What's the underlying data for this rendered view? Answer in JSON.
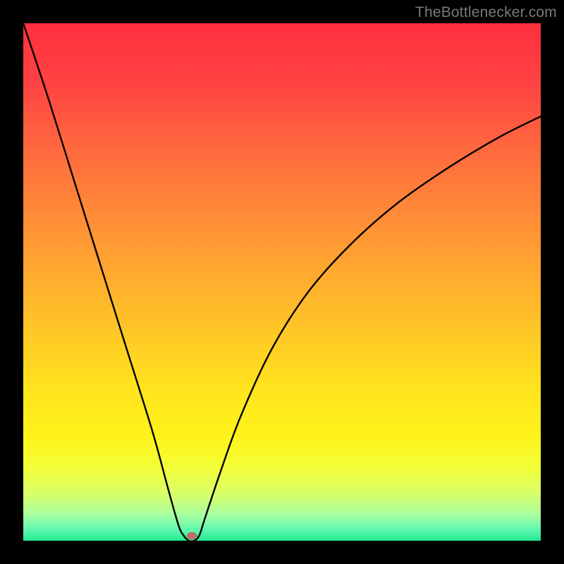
{
  "source_label": "TheBottlenecker.com",
  "gradient": {
    "stops": [
      {
        "offset": "0%",
        "color": "#ff2f3f"
      },
      {
        "offset": "12%",
        "color": "#ff4443"
      },
      {
        "offset": "25%",
        "color": "#ff6b3e"
      },
      {
        "offset": "40%",
        "color": "#ff9335"
      },
      {
        "offset": "55%",
        "color": "#ffbb2a"
      },
      {
        "offset": "70%",
        "color": "#ffe21e"
      },
      {
        "offset": "80%",
        "color": "#fff31a"
      },
      {
        "offset": "86%",
        "color": "#f2ff3a"
      },
      {
        "offset": "91%",
        "color": "#d7ff6a"
      },
      {
        "offset": "95%",
        "color": "#a8ffa0"
      },
      {
        "offset": "98%",
        "color": "#5bf6b0"
      },
      {
        "offset": "100%",
        "color": "#23e88f"
      }
    ]
  },
  "marker": {
    "x_pct": 32.5,
    "y_pct": 99.0,
    "color": "#c06a60"
  },
  "chart_data": {
    "type": "line",
    "title": "",
    "xlabel": "",
    "ylabel": "",
    "xlim": [
      0,
      100
    ],
    "ylim": [
      0,
      100
    ],
    "series": [
      {
        "name": "bottleneck-curve",
        "x": [
          0,
          5,
          10,
          15,
          20,
          25,
          28,
          30,
          31,
          32,
          33,
          34,
          35,
          38,
          42,
          48,
          55,
          63,
          72,
          82,
          92,
          100
        ],
        "y": [
          100,
          85,
          69,
          53,
          37,
          21,
          10,
          3,
          1,
          0,
          0,
          1,
          4,
          13,
          24,
          37,
          48,
          57,
          65,
          72,
          78,
          82
        ]
      }
    ],
    "annotations": [
      {
        "text": "TheBottlenecker.com",
        "position": "top-right"
      }
    ],
    "marker_point": {
      "x": 32.5,
      "y": 1.0
    }
  }
}
